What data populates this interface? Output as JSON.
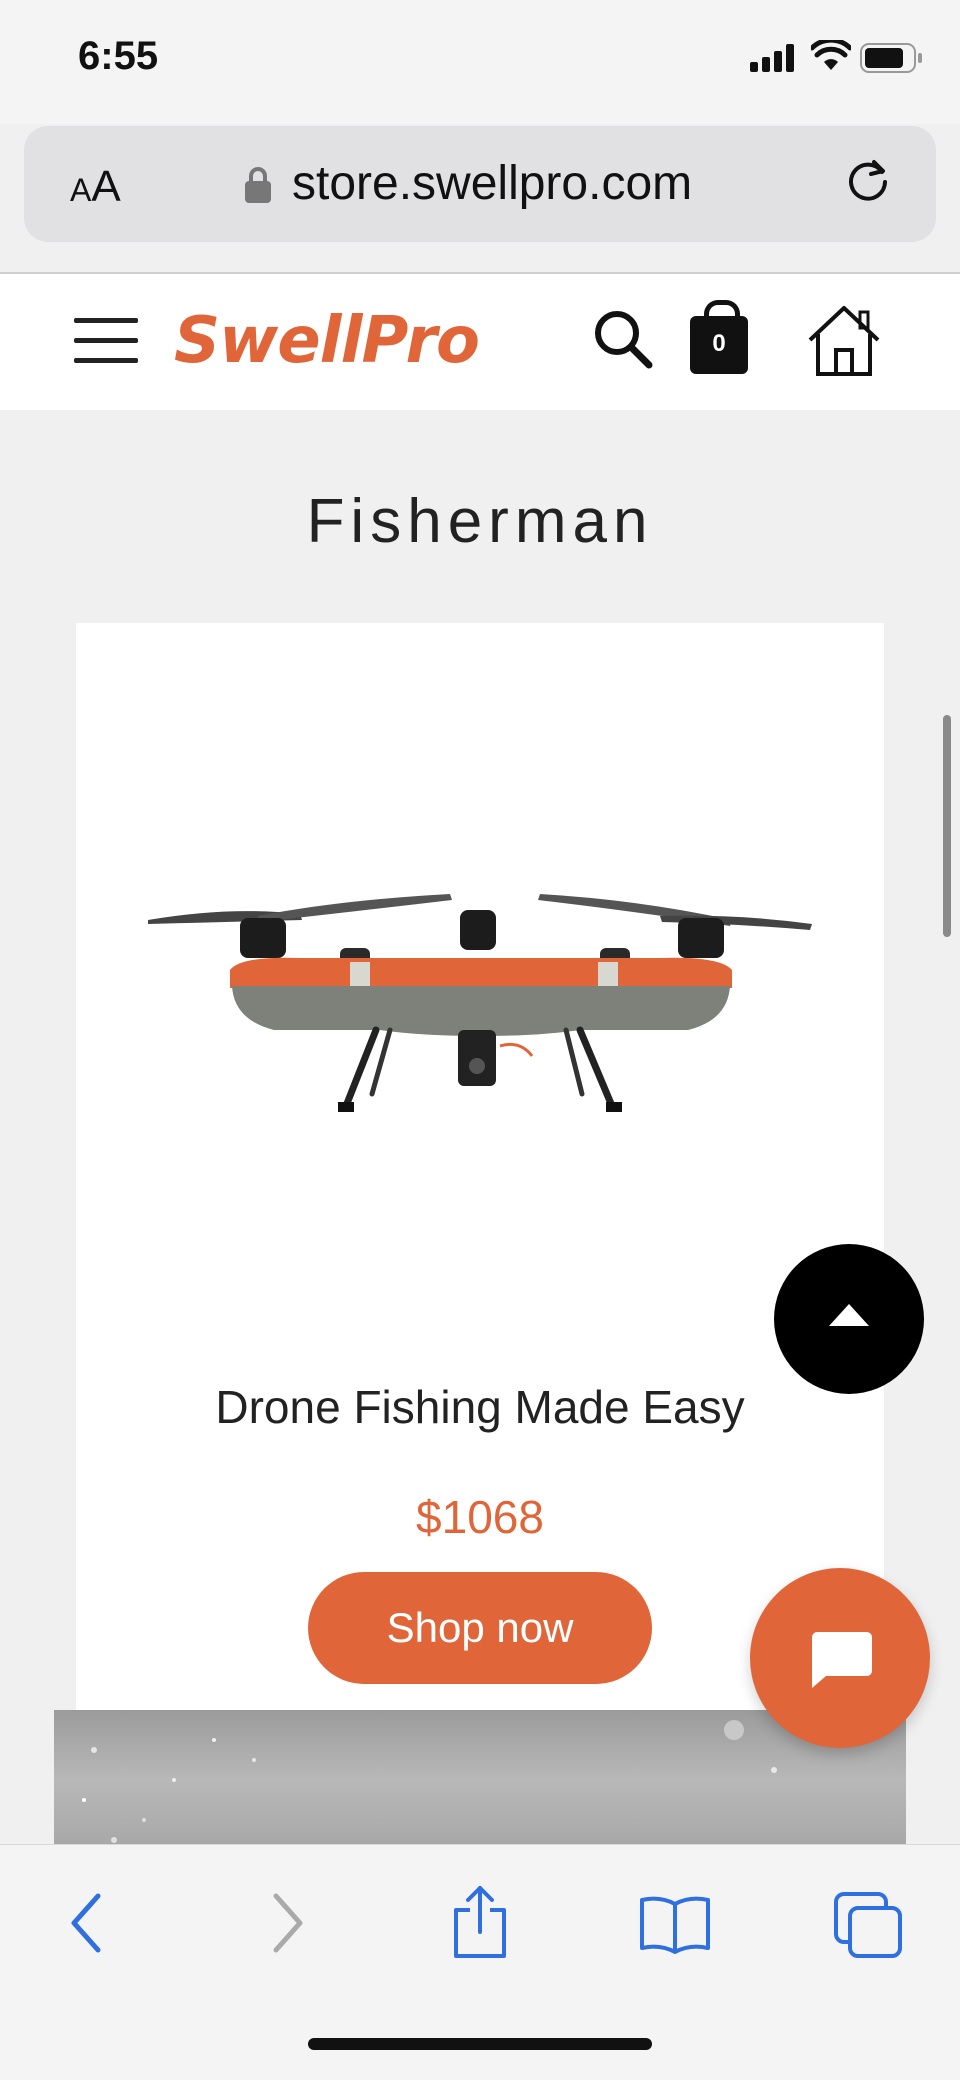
{
  "status_bar": {
    "time": "6:55"
  },
  "browser": {
    "text_size_label_small": "A",
    "text_size_label_large": "A",
    "url": "store.swellpro.com"
  },
  "site_header": {
    "brand": "SwellPro",
    "cart_count": "0",
    "brand_color": "#e0663a"
  },
  "page": {
    "title": "Fisherman"
  },
  "product": {
    "name": "Drone Fishing Made Easy",
    "price": "$1068",
    "cta_label": "Shop now"
  },
  "icons": [
    "menu-icon",
    "search-icon",
    "shopping-bag-icon",
    "home-icon",
    "lock-icon",
    "reload-icon",
    "chevron-up-icon",
    "chat-icon",
    "back-icon",
    "forward-icon",
    "share-icon",
    "bookmarks-icon",
    "tabs-icon"
  ]
}
